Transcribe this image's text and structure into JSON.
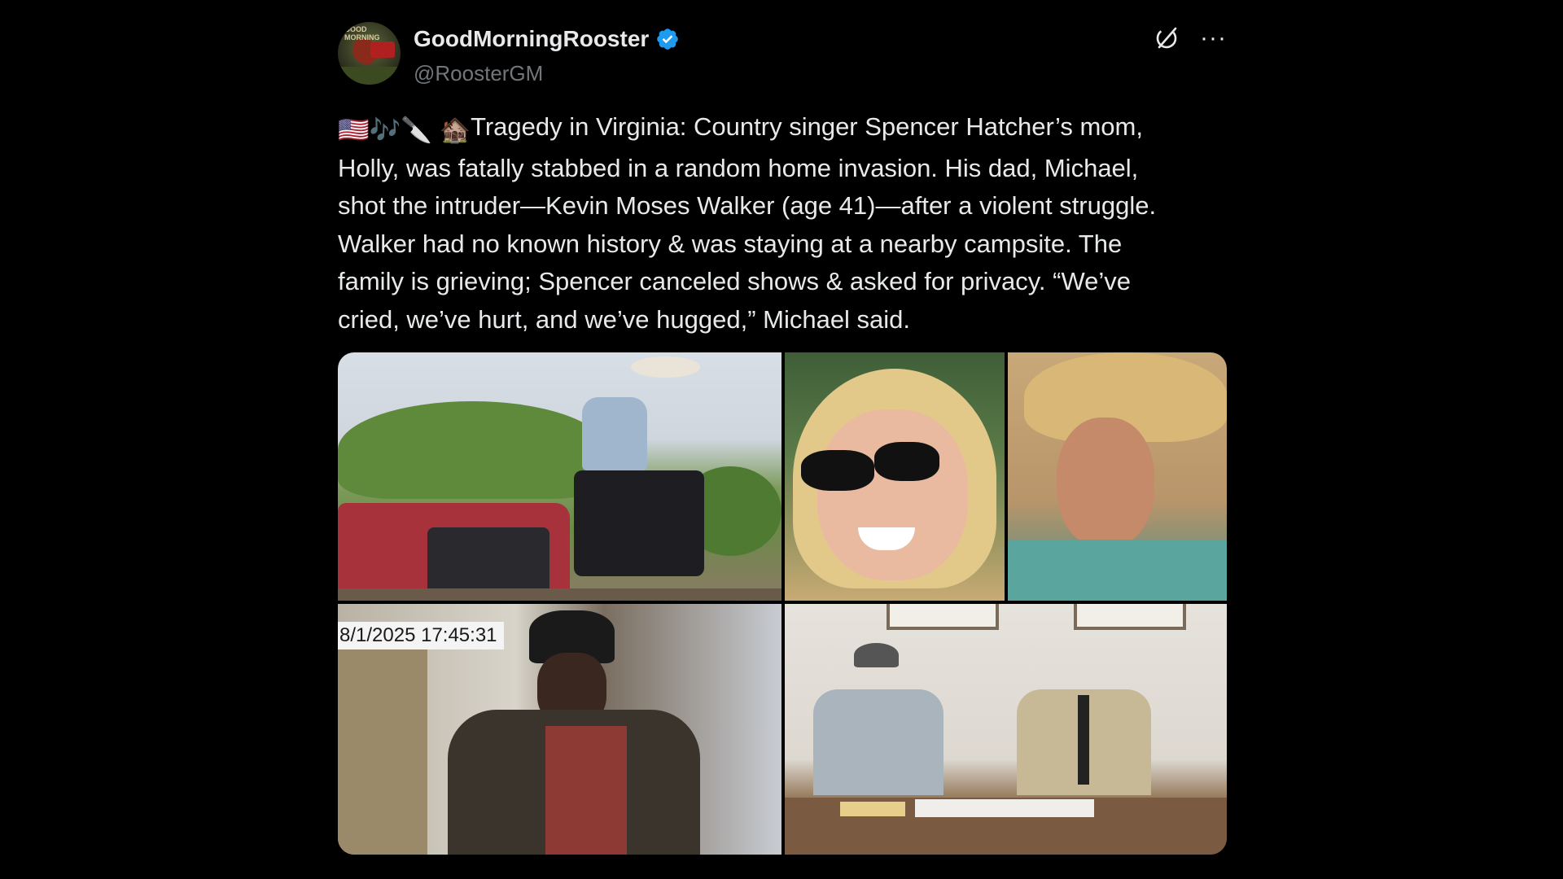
{
  "author": {
    "display_name": "GoodMorningRooster",
    "handle": "@RoosterGM",
    "avatar_text": "GOOD MORNING",
    "verified": true,
    "verified_color": "#1d9bf0"
  },
  "actions": {
    "grok_icon": "grok-icon",
    "more_label": "···"
  },
  "tweet": {
    "emojis": [
      "🇺🇸",
      "🎶",
      "🔪",
      "🏚️"
    ],
    "lines": [
      "Tragedy in Virginia: Country singer Spencer Hatcher’s mom,",
      "Holly, was fatally stabbed in a random home invasion. His dad, Michael,",
      "shot the intruder—Kevin Moses Walker (age 41)—after a violent struggle.",
      "Walker had no known history & was staying at a nearby campsite. The",
      "family is grieving; Spencer canceled shows & asked for privacy. “We’ve",
      "cried, we’ve hurt, and we’ve hugged,” Michael said."
    ]
  },
  "media": {
    "photos": [
      {
        "name": "photo-man-on-truck"
      },
      {
        "name": "photo-woman-sunglasses"
      },
      {
        "name": "photo-man-cowboy-hat"
      },
      {
        "name": "photo-security-camera",
        "timestamp": "8/1/2025 17:45:31"
      },
      {
        "name": "photo-press-conference"
      }
    ]
  }
}
